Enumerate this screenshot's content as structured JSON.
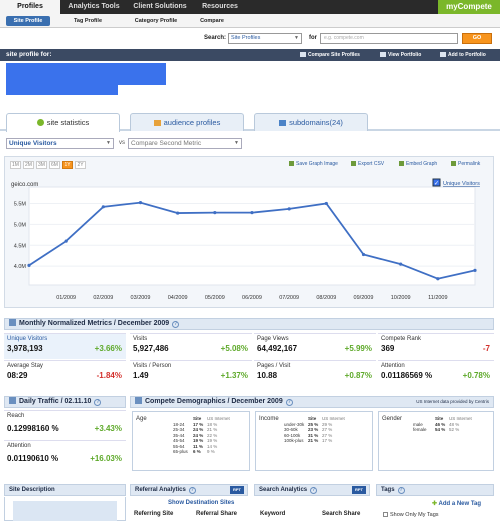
{
  "nav": {
    "items": [
      "Profiles",
      "Analytics Tools",
      "Client Solutions",
      "Resources"
    ],
    "brand": "myCompete"
  },
  "subnav": {
    "items": [
      "Site Profile",
      "Tag Profile",
      "Category Profile",
      "Compare"
    ]
  },
  "search": {
    "label": "Search:",
    "type_value": "Site Profiles",
    "for_label": "for",
    "placeholder": "e.g. compete.com",
    "go_label": "GO"
  },
  "profile": {
    "title": "site profile for:",
    "actions": [
      "Compare Site Profiles",
      "View Portfolio",
      "Add to Portfolio"
    ]
  },
  "tabs": [
    {
      "label": "site statistics"
    },
    {
      "label": "audience profiles"
    },
    {
      "label": "subdomains",
      "count": "(24)"
    }
  ],
  "metric_select": {
    "primary": "Unique Visitors",
    "vs": "vs",
    "secondary": "Compare Second Metric"
  },
  "ranges": [
    "1M",
    "2M",
    "3M",
    "6M",
    "1Y",
    "2Y"
  ],
  "active_range": "1Y",
  "tools": [
    "Save Graph Image",
    "Export CSV",
    "Embed Graph",
    "Permalink"
  ],
  "chart_data": {
    "type": "line",
    "site_label": "geico.com",
    "legend": "Unique Visitors",
    "legend_checked": true,
    "x": [
      "12/2008",
      "01/2009",
      "02/2009",
      "03/2009",
      "04/2009",
      "05/2009",
      "06/2009",
      "07/2009",
      "08/2009",
      "09/2009",
      "10/2009",
      "11/2009",
      "12/2009"
    ],
    "x_tick_labels": [
      "01/2009",
      "02/2009",
      "03/2009",
      "04/2009",
      "05/2009",
      "06/2009",
      "07/2009",
      "08/2009",
      "09/2009",
      "10/2009",
      "11/2009"
    ],
    "y": [
      4.02,
      4.6,
      5.42,
      5.52,
      5.27,
      5.28,
      5.28,
      5.37,
      5.5,
      4.28,
      4.05,
      3.7,
      3.9
    ],
    "y_ticks": [
      "4.0M",
      "4.5M",
      "5.0M",
      "5.5M"
    ],
    "ylim": [
      3.55,
      5.75
    ],
    "color": "#3f6fc4"
  },
  "monthly": {
    "title": "Monthly Normalized Metrics / December 2009",
    "cells": [
      {
        "label": "Unique Visitors",
        "value": "3,978,193",
        "change": "+3.66%",
        "dir": "up"
      },
      {
        "label": "Visits",
        "value": "5,927,486",
        "change": "+5.08%",
        "dir": "up"
      },
      {
        "label": "Page Views",
        "value": "64,492,167",
        "change": "+5.99%",
        "dir": "up"
      },
      {
        "label": "Compete Rank",
        "value": "369",
        "change": "-7",
        "dir": "dn"
      },
      {
        "label": "Average Stay",
        "value": "08:29",
        "change": "-1.84%",
        "dir": "dn"
      },
      {
        "label": "Visits / Person",
        "value": "1.49",
        "change": "+1.37%",
        "dir": "up"
      },
      {
        "label": "Pages / Visit",
        "value": "10.88",
        "change": "+0.87%",
        "dir": "up"
      },
      {
        "label": "Attention",
        "value": "0.01186569 %",
        "change": "+0.78%",
        "dir": "up"
      }
    ]
  },
  "daily": {
    "title": "Daily Traffic / 02.11.10",
    "cells": [
      {
        "label": "Reach",
        "value": "0.12998160 %",
        "change": "+3.43%"
      },
      {
        "label": "Attention",
        "value": "0.01190610 %",
        "change": "+16.03%"
      }
    ]
  },
  "demographics": {
    "title": "Compete Demographics / December 2009",
    "note": "US Internet data provided by Centris",
    "age": {
      "label": "Age",
      "headers": [
        "Site",
        "US Internet"
      ],
      "rows": [
        [
          "18-24",
          "17 %",
          "18 %"
        ],
        [
          "25-34",
          "24 %",
          "21 %"
        ],
        [
          "35-44",
          "24 %",
          "22 %"
        ],
        [
          "45-54",
          "19 %",
          "19 %"
        ],
        [
          "55-64",
          "11 %",
          "14 %"
        ],
        [
          "65-plus",
          "6 %",
          "9 %"
        ]
      ]
    },
    "income": {
      "label": "Income",
      "headers": [
        "Site",
        "US Internet"
      ],
      "rows": [
        [
          "under-30k",
          "25 %",
          "29 %"
        ],
        [
          "30-60k",
          "23 %",
          "27 %"
        ],
        [
          "60-100k",
          "31 %",
          "27 %"
        ],
        [
          "100k-plus",
          "21 %",
          "17 %"
        ]
      ]
    },
    "gender": {
      "label": "Gender",
      "headers": [
        "Site",
        "US Internet"
      ],
      "rows": [
        [
          "male",
          "46 %",
          "48 %"
        ],
        [
          "female",
          "54 %",
          "52 %"
        ]
      ]
    }
  },
  "bottom": {
    "site_description": "Site Description",
    "referral": {
      "title": "Referral Analytics",
      "badge": "RPT",
      "link": "Show Destination Sites",
      "cols": [
        "Referring Site",
        "Referral Share"
      ]
    },
    "search": {
      "title": "Search Analytics",
      "badge": "RPT",
      "cols": [
        "Keyword",
        "Search Share"
      ]
    },
    "tags": {
      "title": "Tags",
      "add": "Add a New Tag",
      "show": "Show Only My Tags"
    }
  }
}
